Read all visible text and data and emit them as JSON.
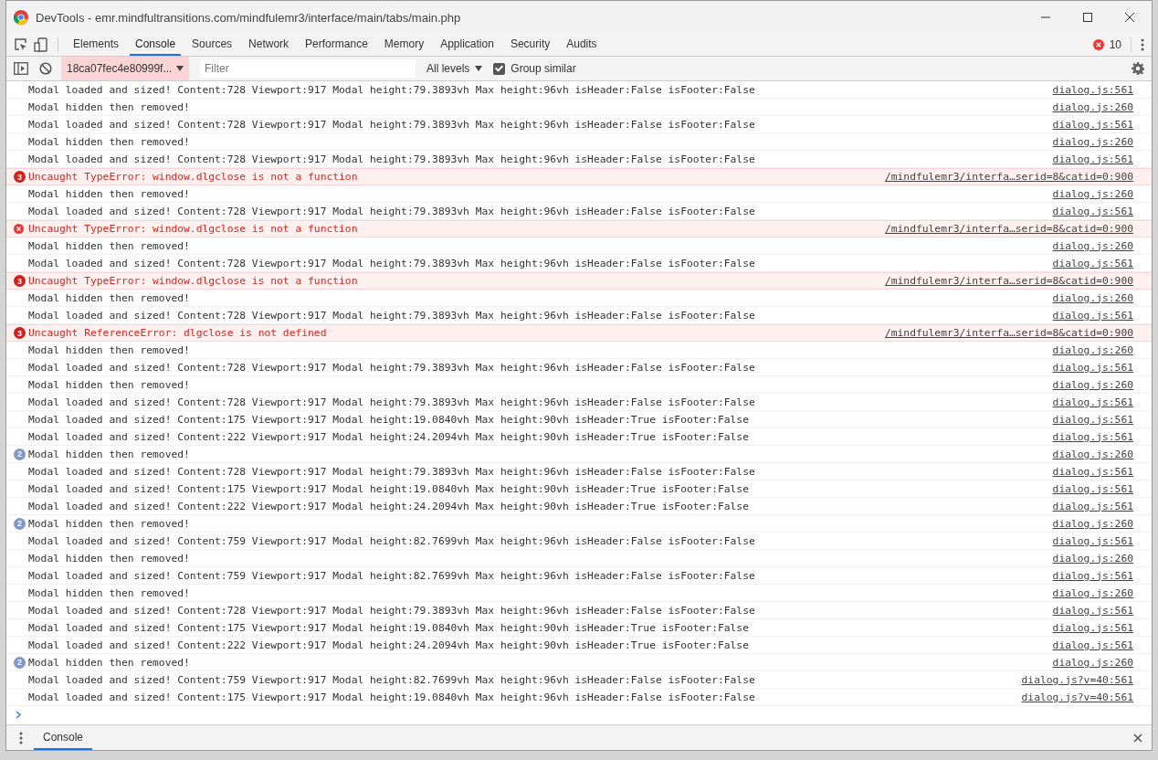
{
  "window": {
    "title": "DevTools - emr.mindfultransitions.com/mindfulemr3/interface/main/tabs/main.php"
  },
  "tabs": [
    {
      "label": "Elements",
      "selected": false
    },
    {
      "label": "Console",
      "selected": true
    },
    {
      "label": "Sources",
      "selected": false
    },
    {
      "label": "Network",
      "selected": false
    },
    {
      "label": "Performance",
      "selected": false
    },
    {
      "label": "Memory",
      "selected": false
    },
    {
      "label": "Application",
      "selected": false
    },
    {
      "label": "Security",
      "selected": false
    },
    {
      "label": "Audits",
      "selected": false
    }
  ],
  "error_count": "10",
  "toolbar": {
    "context": "18ca07fec4e80999f...",
    "filter": {
      "placeholder": "Filter"
    },
    "levels": "All levels",
    "group_similar": {
      "label": "Group similar",
      "checked": true
    }
  },
  "messages": [
    {
      "kind": "log",
      "text": "Modal loaded and sized! Content:728 Viewport:917 Modal height:79.3893vh Max height:96vh isHeader:False isFooter:False",
      "source": "dialog.js:561"
    },
    {
      "kind": "log",
      "text": "Modal hidden then removed!",
      "source": "dialog.js:260"
    },
    {
      "kind": "log",
      "text": "Modal loaded and sized! Content:728 Viewport:917 Modal height:79.3893vh Max height:96vh isHeader:False isFooter:False",
      "source": "dialog.js:561"
    },
    {
      "kind": "log",
      "text": "Modal hidden then removed!",
      "source": "dialog.js:260"
    },
    {
      "kind": "log",
      "text": "Modal loaded and sized! Content:728 Viewport:917 Modal height:79.3893vh Max height:96vh isHeader:False isFooter:False",
      "source": "dialog.js:561"
    },
    {
      "kind": "error",
      "count": "3",
      "text": "Uncaught TypeError: window.dlgclose is not a function",
      "source": "/mindfulemr3/interfa…serid=8&catid=0:900"
    },
    {
      "kind": "log",
      "text": "Modal hidden then removed!",
      "source": "dialog.js:260"
    },
    {
      "kind": "log",
      "text": "Modal loaded and sized! Content:728 Viewport:917 Modal height:79.3893vh Max height:96vh isHeader:False isFooter:False",
      "source": "dialog.js:561"
    },
    {
      "kind": "error",
      "text": "Uncaught TypeError: window.dlgclose is not a function",
      "source": "/mindfulemr3/interfa…serid=8&catid=0:900"
    },
    {
      "kind": "log",
      "text": "Modal hidden then removed!",
      "source": "dialog.js:260"
    },
    {
      "kind": "log",
      "text": "Modal loaded and sized! Content:728 Viewport:917 Modal height:79.3893vh Max height:96vh isHeader:False isFooter:False",
      "source": "dialog.js:561"
    },
    {
      "kind": "error",
      "count": "3",
      "text": "Uncaught TypeError: window.dlgclose is not a function",
      "source": "/mindfulemr3/interfa…serid=8&catid=0:900"
    },
    {
      "kind": "log",
      "text": "Modal hidden then removed!",
      "source": "dialog.js:260"
    },
    {
      "kind": "log",
      "text": "Modal loaded and sized! Content:728 Viewport:917 Modal height:79.3893vh Max height:96vh isHeader:False isFooter:False",
      "source": "dialog.js:561"
    },
    {
      "kind": "error",
      "count": "3",
      "text": "Uncaught ReferenceError: dlgclose is not defined",
      "source": "/mindfulemr3/interfa…serid=8&catid=0:900"
    },
    {
      "kind": "log",
      "text": "Modal hidden then removed!",
      "source": "dialog.js:260"
    },
    {
      "kind": "log",
      "text": "Modal loaded and sized! Content:728 Viewport:917 Modal height:79.3893vh Max height:96vh isHeader:False isFooter:False",
      "source": "dialog.js:561"
    },
    {
      "kind": "log",
      "text": "Modal hidden then removed!",
      "source": "dialog.js:260"
    },
    {
      "kind": "log",
      "text": "Modal loaded and sized! Content:728 Viewport:917 Modal height:79.3893vh Max height:96vh isHeader:False isFooter:False",
      "source": "dialog.js:561"
    },
    {
      "kind": "log",
      "text": "Modal loaded and sized! Content:175 Viewport:917 Modal height:19.0840vh Max height:90vh isHeader:True isFooter:False",
      "source": "dialog.js:561"
    },
    {
      "kind": "log",
      "text": "Modal loaded and sized! Content:222 Viewport:917 Modal height:24.2094vh Max height:90vh isHeader:True isFooter:False",
      "source": "dialog.js:561"
    },
    {
      "kind": "log",
      "count": "2",
      "text": "Modal hidden then removed!",
      "source": "dialog.js:260"
    },
    {
      "kind": "log",
      "text": "Modal loaded and sized! Content:728 Viewport:917 Modal height:79.3893vh Max height:96vh isHeader:False isFooter:False",
      "source": "dialog.js:561"
    },
    {
      "kind": "log",
      "text": "Modal loaded and sized! Content:175 Viewport:917 Modal height:19.0840vh Max height:90vh isHeader:True isFooter:False",
      "source": "dialog.js:561"
    },
    {
      "kind": "log",
      "text": "Modal loaded and sized! Content:222 Viewport:917 Modal height:24.2094vh Max height:90vh isHeader:True isFooter:False",
      "source": "dialog.js:561"
    },
    {
      "kind": "log",
      "count": "2",
      "text": "Modal hidden then removed!",
      "source": "dialog.js:260"
    },
    {
      "kind": "log",
      "text": "Modal loaded and sized! Content:759 Viewport:917 Modal height:82.7699vh Max height:96vh isHeader:False isFooter:False",
      "source": "dialog.js:561"
    },
    {
      "kind": "log",
      "text": "Modal hidden then removed!",
      "source": "dialog.js:260"
    },
    {
      "kind": "log",
      "text": "Modal loaded and sized! Content:759 Viewport:917 Modal height:82.7699vh Max height:96vh isHeader:False isFooter:False",
      "source": "dialog.js:561"
    },
    {
      "kind": "log",
      "text": "Modal hidden then removed!",
      "source": "dialog.js:260"
    },
    {
      "kind": "log",
      "text": "Modal loaded and sized! Content:728 Viewport:917 Modal height:79.3893vh Max height:96vh isHeader:False isFooter:False",
      "source": "dialog.js:561"
    },
    {
      "kind": "log",
      "text": "Modal loaded and sized! Content:175 Viewport:917 Modal height:19.0840vh Max height:90vh isHeader:True isFooter:False",
      "source": "dialog.js:561"
    },
    {
      "kind": "log",
      "text": "Modal loaded and sized! Content:222 Viewport:917 Modal height:24.2094vh Max height:90vh isHeader:True isFooter:False",
      "source": "dialog.js:561"
    },
    {
      "kind": "log",
      "count": "2",
      "text": "Modal hidden then removed!",
      "source": "dialog.js:260"
    },
    {
      "kind": "log",
      "text": "Modal loaded and sized! Content:759 Viewport:917 Modal height:82.7699vh Max height:96vh isHeader:False isFooter:False",
      "source": "dialog.js?v=40:561"
    },
    {
      "kind": "log",
      "text": "Modal loaded and sized! Content:175 Viewport:917 Modal height:19.0840vh Max height:96vh isHeader:False isFooter:False",
      "source": "dialog.js?v=40:561"
    }
  ],
  "drawer": {
    "tabs": [
      {
        "label": "Console",
        "selected": true
      }
    ]
  }
}
